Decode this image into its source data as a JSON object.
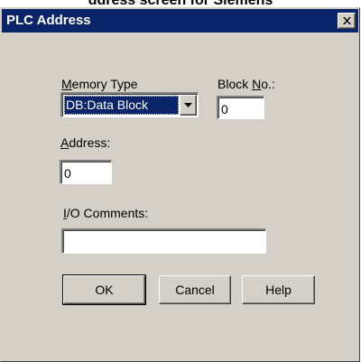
{
  "caption": "ddress screen for Siemens",
  "window": {
    "title": "PLC Address",
    "close_label": "×"
  },
  "form": {
    "memory_type": {
      "label_accel": "M",
      "label_rest": "emory Type",
      "selected": "DB:Data Block"
    },
    "block_no": {
      "label_pre": "Block ",
      "label_accel": "N",
      "label_post": "o.:",
      "value": "0"
    },
    "address": {
      "label_accel": "A",
      "label_rest": "ddress:",
      "value": "0"
    },
    "io_comments": {
      "label_accel": "I",
      "label_rest": "/O Comments:",
      "value": ""
    }
  },
  "buttons": {
    "ok": "OK",
    "cancel": "Cancel",
    "help": "Help"
  },
  "colors": {
    "titlebar": "#0a246a",
    "face": "#d4d0c8",
    "selection": "#0a246a"
  }
}
